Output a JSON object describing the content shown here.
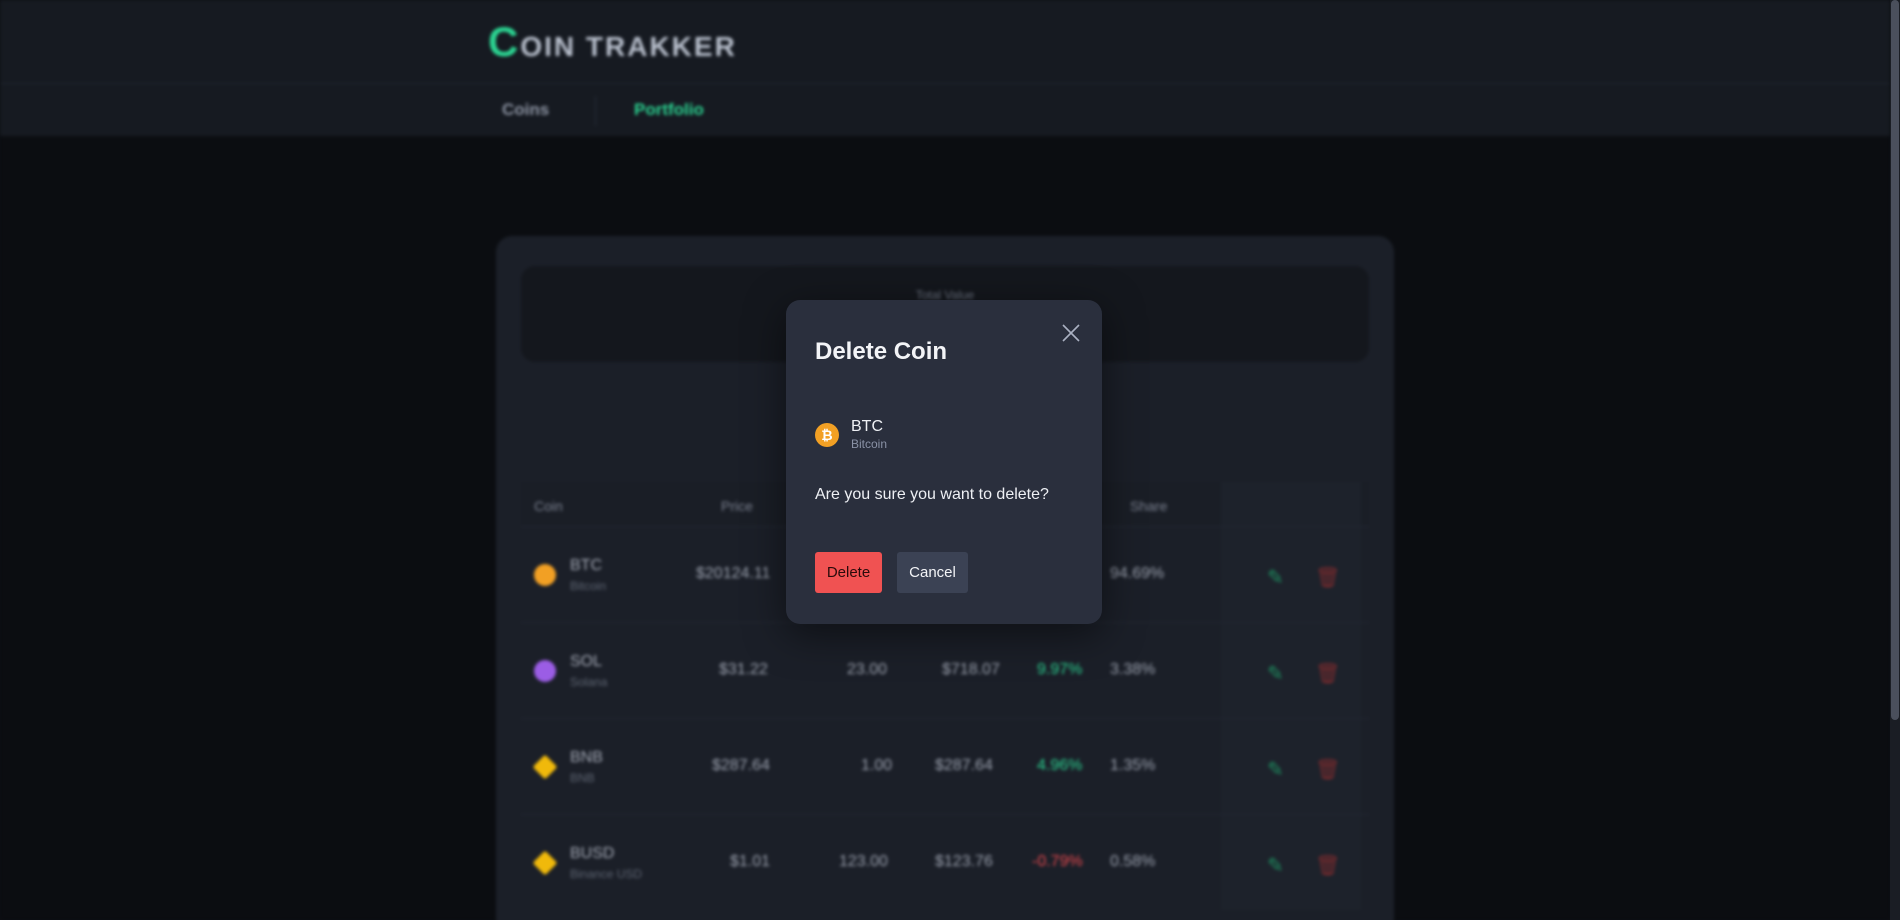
{
  "app": {
    "logo_first": "C",
    "logo_rest": "OIN TRAKKER"
  },
  "nav": {
    "tabs": [
      {
        "label": "Coins",
        "active": false
      },
      {
        "label": "Portfolio",
        "active": true
      }
    ]
  },
  "portfolio": {
    "total_label": "Total Value",
    "headers": {
      "coin": "Coin",
      "price": "Price",
      "share": "Share"
    },
    "rows": [
      {
        "symbol": "BTC",
        "name": "Bitcoin",
        "price": "$20124.11",
        "holdings": "",
        "value": "",
        "change": "",
        "change_dir": "",
        "share": "94.69%",
        "icon_color": "#f2a024"
      },
      {
        "symbol": "SOL",
        "name": "Solana",
        "price": "$31.22",
        "holdings": "23.00",
        "value": "$718.07",
        "change": "9.97%",
        "change_dir": "up",
        "share": "3.38%",
        "icon_color": "#9b5de5"
      },
      {
        "symbol": "BNB",
        "name": "BNB",
        "price": "$287.64",
        "holdings": "1.00",
        "value": "$287.64",
        "change": "4.96%",
        "change_dir": "up",
        "share": "1.35%",
        "icon_color": "#f0b90b"
      },
      {
        "symbol": "BUSD",
        "name": "Binance USD",
        "price": "$1.01",
        "holdings": "123.00",
        "value": "$123.76",
        "change": "-0.79%",
        "change_dir": "down",
        "share": "0.58%",
        "icon_color": "#f0b90b"
      }
    ]
  },
  "modal": {
    "title": "Delete Coin",
    "coin_symbol": "BTC",
    "coin_name": "Bitcoin",
    "coin_icon_glyph": "₿",
    "message": "Are you sure you want to delete?",
    "delete_label": "Delete",
    "cancel_label": "Cancel",
    "close_icon": "close-icon"
  },
  "colors": {
    "accent": "#2bd391",
    "danger": "#f05252",
    "bitcoin": "#f2a024"
  }
}
